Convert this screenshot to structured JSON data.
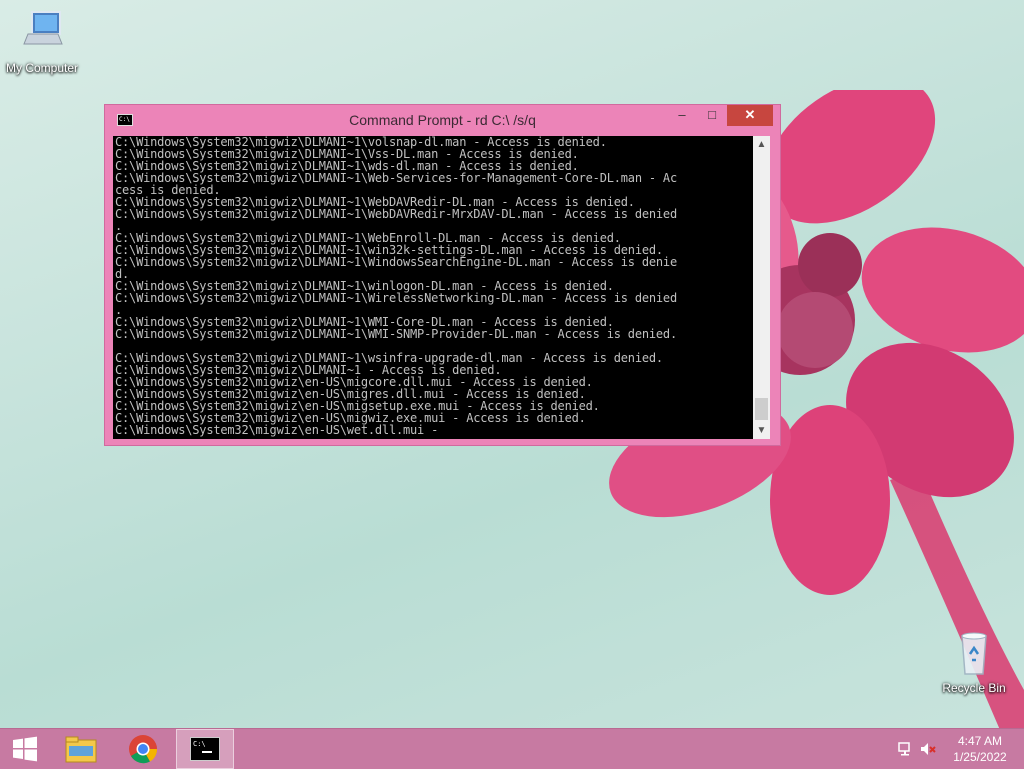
{
  "desktop": {
    "icons": [
      {
        "label": "My Computer",
        "icon": "computer-icon"
      },
      {
        "label": "Recycle Bin",
        "icon": "recycle-bin-icon"
      }
    ]
  },
  "window": {
    "title": "Command Prompt - rd  C:\\ /s/q",
    "minimize": "–",
    "maximize": "□",
    "close": "✕",
    "lines": [
      "C:\\Windows\\System32\\migwiz\\DLMANI~1\\volsnap-dl.man - Access is denied.",
      "C:\\Windows\\System32\\migwiz\\DLMANI~1\\Vss-DL.man - Access is denied.",
      "C:\\Windows\\System32\\migwiz\\DLMANI~1\\wds-dl.man - Access is denied.",
      "C:\\Windows\\System32\\migwiz\\DLMANI~1\\Web-Services-for-Management-Core-DL.man - Ac",
      "cess is denied.",
      "C:\\Windows\\System32\\migwiz\\DLMANI~1\\WebDAVRedir-DL.man - Access is denied.",
      "C:\\Windows\\System32\\migwiz\\DLMANI~1\\WebDAVRedir-MrxDAV-DL.man - Access is denied",
      ".",
      "C:\\Windows\\System32\\migwiz\\DLMANI~1\\WebEnroll-DL.man - Access is denied.",
      "C:\\Windows\\System32\\migwiz\\DLMANI~1\\win32k-settings-DL.man - Access is denied.",
      "C:\\Windows\\System32\\migwiz\\DLMANI~1\\WindowsSearchEngine-DL.man - Access is denie",
      "d.",
      "C:\\Windows\\System32\\migwiz\\DLMANI~1\\winlogon-DL.man - Access is denied.",
      "C:\\Windows\\System32\\migwiz\\DLMANI~1\\WirelessNetworking-DL.man - Access is denied",
      ".",
      "C:\\Windows\\System32\\migwiz\\DLMANI~1\\WMI-Core-DL.man - Access is denied.",
      "C:\\Windows\\System32\\migwiz\\DLMANI~1\\WMI-SNMP-Provider-DL.man - Access is denied.",
      "",
      "C:\\Windows\\System32\\migwiz\\DLMANI~1\\wsinfra-upgrade-dl.man - Access is denied.",
      "C:\\Windows\\System32\\migwiz\\DLMANI~1 - Access is denied.",
      "C:\\Windows\\System32\\migwiz\\en-US\\migcore.dll.mui - Access is denied.",
      "C:\\Windows\\System32\\migwiz\\en-US\\migres.dll.mui - Access is denied.",
      "C:\\Windows\\System32\\migwiz\\en-US\\migsetup.exe.mui - Access is denied.",
      "C:\\Windows\\System32\\migwiz\\en-US\\migwiz.exe.mui - Access is denied.",
      "C:\\Windows\\System32\\migwiz\\en-US\\wet.dll.mui -"
    ]
  },
  "taskbar": {
    "items": [
      "start-icon",
      "file-explorer-icon",
      "chrome-icon",
      "command-prompt-icon"
    ],
    "clock": {
      "time": "4:47 AM",
      "date": "1/25/2022"
    }
  },
  "colors": {
    "taskbar": "#c77aa2",
    "window_frame": "#ec84b8",
    "close_button": "#c7463f",
    "console_bg": "#000000",
    "console_text": "#c0c0c0"
  }
}
